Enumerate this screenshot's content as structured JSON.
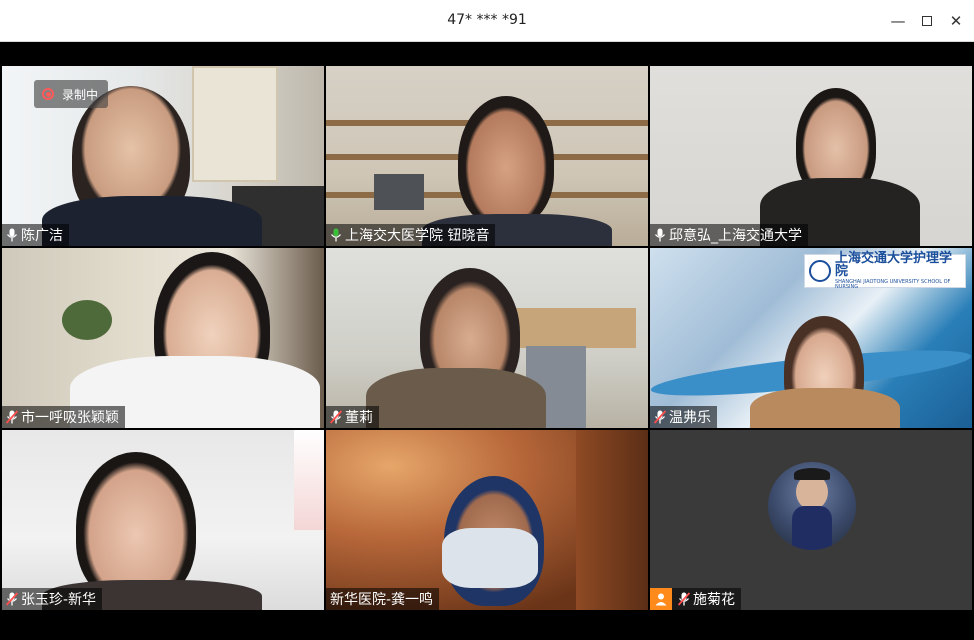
{
  "window": {
    "title": "47* *** *91",
    "minimize_glyph": "—",
    "close_glyph": "✕"
  },
  "recording": {
    "label": "录制中",
    "color": "#ff5a5a"
  },
  "colors": {
    "active_speaker_border": "#3bbf3b",
    "mic_active": "#3bbf3b",
    "mic_muted": "#ff4d4d",
    "avatar_badge": "#ff8a1c"
  },
  "participants": [
    {
      "name": "陈广洁",
      "mic": "on",
      "active": false,
      "icon": "mic-icon"
    },
    {
      "name": "上海交大医学院 钮晓音",
      "mic": "speaking",
      "active": true,
      "icon": "mic-icon"
    },
    {
      "name": "邱意弘_上海交通大学",
      "mic": "on",
      "active": false,
      "icon": "mic-icon"
    },
    {
      "name": "市一呼吸张颖颖",
      "mic": "muted",
      "active": false,
      "icon": "mic-muted-icon"
    },
    {
      "name": "董莉",
      "mic": "muted",
      "active": false,
      "icon": "mic-muted-icon"
    },
    {
      "name": "温弗乐",
      "mic": "muted",
      "active": false,
      "icon": "mic-muted-icon"
    },
    {
      "name": "张玉珍-新华",
      "mic": "muted",
      "active": false,
      "icon": "mic-muted-icon"
    },
    {
      "name": "新华医院-龚一鸣",
      "mic": "none",
      "active": false,
      "icon": ""
    },
    {
      "name": "施菊花",
      "mic": "muted",
      "active": false,
      "icon": "mic-muted-icon",
      "video_off": true
    }
  ],
  "background_logo": {
    "main": "上海交通大学护理学院",
    "sub": "SHANGHAI JIAOTONG UNIVERSITY SCHOOL OF NURSING"
  }
}
